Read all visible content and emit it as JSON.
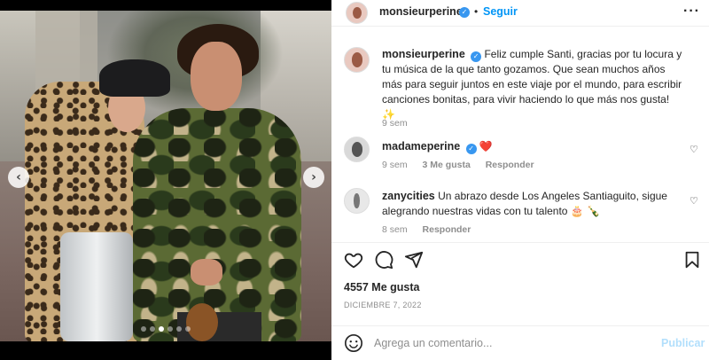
{
  "post": {
    "author": "monsieurperine",
    "follow_label": "Seguir",
    "separator": "•",
    "more_label": "···"
  },
  "carousel": {
    "prev_label": "‹",
    "next_label": "›",
    "dot_count": 6,
    "active_dot": 2
  },
  "caption": {
    "username": "monsieurperine",
    "text": "Feliz cumple Santi, gracias por tu locura y tu música de la que tanto gozamos. Que sean muchos años más para seguir juntos en este viaje por el mundo, para escribir canciones bonitas, para vivir haciendo lo que más nos gusta! ✨",
    "time": "9 sem"
  },
  "comments": [
    {
      "username": "madameperine",
      "text": "❤️",
      "time": "9 sem",
      "likes": "3 Me gusta",
      "reply": "Responder"
    },
    {
      "username": "zanycities",
      "text": "Un abrazo desde Los Angeles Santiaguito, sigue alegrando nuestras vidas con tu talento 🎂 🍾",
      "time": "8 sem",
      "reply": "Responder"
    }
  ],
  "stats": {
    "likes": "4557 Me gusta",
    "date": "DICIEMBRE 7, 2022"
  },
  "add_comment": {
    "placeholder": "Agrega un comentario...",
    "publish_label": "Publicar"
  },
  "colors": {
    "accent": "#0095f6",
    "verified": "#3897f0",
    "publish_disabled": "#b2dffc",
    "heart": "#ed4956"
  }
}
